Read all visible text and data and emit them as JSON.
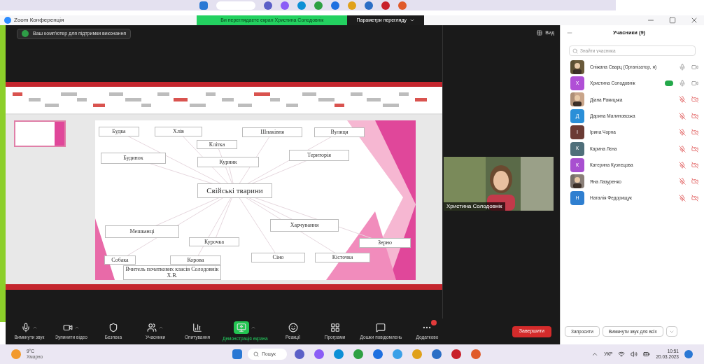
{
  "window": {
    "title": "Zoom Конференція"
  },
  "share_banner": {
    "text": "Ви переглядаєте екран Христина Солодовнік",
    "options": "Параметри перегляду"
  },
  "notice": "Ваш комп'ютер для підтримки виконання",
  "view_button": "Вид",
  "slide": {
    "nodes": [
      {
        "text": "Будка"
      },
      {
        "text": "Хлів"
      },
      {
        "text": "Клітка"
      },
      {
        "text": "Будинок"
      },
      {
        "text": "Курник"
      },
      {
        "text": "Шпаківня"
      },
      {
        "text": "Вулиця"
      },
      {
        "text": "Територія"
      },
      {
        "text": "Свійські тварини"
      },
      {
        "text": "Харчування"
      },
      {
        "text": "Зерно"
      },
      {
        "text": "Сіно"
      },
      {
        "text": "Кісточка"
      },
      {
        "text": "Мешканці"
      },
      {
        "text": "Курочка"
      },
      {
        "text": "Собака"
      },
      {
        "text": "Корова"
      }
    ],
    "caption": "Вчитель початкових класів Солодовнік Х.В."
  },
  "video_tile": {
    "name": "Христина Солодовнік"
  },
  "toolbar": [
    {
      "label": "Вимкнути звук",
      "kind": "mic",
      "caret": true,
      "active": false,
      "badge": false
    },
    {
      "label": "Зупинити відео",
      "kind": "video",
      "caret": true,
      "active": false,
      "badge": false
    },
    {
      "label": "Безпека",
      "kind": "shield",
      "caret": false,
      "active": false,
      "badge": false
    },
    {
      "label": "Учасники",
      "kind": "users",
      "caret": true,
      "active": false,
      "badge": false
    },
    {
      "label": "Опитування",
      "kind": "chart",
      "caret": false,
      "active": false,
      "badge": false
    },
    {
      "label": "Демонстрація екрана",
      "kind": "share",
      "caret": true,
      "active": true,
      "badge": false
    },
    {
      "label": "Реакції",
      "kind": "smile",
      "caret": false,
      "active": false,
      "badge": false
    },
    {
      "label": "Програми",
      "kind": "apps",
      "caret": false,
      "active": false,
      "badge": false
    },
    {
      "label": "Дошки повідомлень",
      "kind": "board",
      "caret": false,
      "active": false,
      "badge": false
    },
    {
      "label": "Додатково",
      "kind": "more",
      "caret": false,
      "active": false,
      "badge": true
    }
  ],
  "end_button": "Завершити",
  "participants": {
    "title": "Учасники (9)",
    "search_placeholder": "Знайти учасника",
    "items": [
      {
        "name": "Сніжана Сварц (Організатор, я)",
        "muted": false,
        "video_off": false,
        "speaking": false
      },
      {
        "name": "Христина Солодовнік",
        "kind": "letter",
        "letter": "Х",
        "color": "#b04fd6",
        "muted": false,
        "video_off": false,
        "speaking": true
      },
      {
        "name": "Діана Ракицька",
        "muted": true,
        "video_off": true,
        "speaking": false
      },
      {
        "name": "Дарина Малиновська",
        "kind": "letter",
        "letter": "Д",
        "color": "#2a8fd8",
        "muted": true,
        "video_off": true,
        "speaking": false
      },
      {
        "name": "Ірина Чорна",
        "kind": "letter",
        "letter": "І",
        "color": "#6b3b34",
        "muted": true,
        "video_off": true,
        "speaking": false
      },
      {
        "name": "Карина Лєна",
        "kind": "letter",
        "letter": "К",
        "color": "#4f6f7a",
        "muted": true,
        "video_off": true,
        "speaking": false
      },
      {
        "name": "Катерина Кузнецова",
        "kind": "letter",
        "letter": "К",
        "color": "#a84fd0",
        "muted": true,
        "video_off": true,
        "speaking": false
      },
      {
        "name": "Яна Лазуренко",
        "muted": true,
        "video_off": true,
        "speaking": false
      },
      {
        "name": "Наталія Федорищук",
        "kind": "letter",
        "letter": "Н",
        "color": "#2f7fd0",
        "muted": true,
        "video_off": true,
        "speaking": false
      }
    ],
    "buttons": [
      "Запросити",
      "Вимкнути звук для всіх"
    ]
  },
  "taskbar": {
    "weather_temp": "9°C",
    "weather_text": "Хмарно",
    "search": "Пошук",
    "language": "УКР",
    "time": "10:51",
    "date": "20.03.2023"
  }
}
